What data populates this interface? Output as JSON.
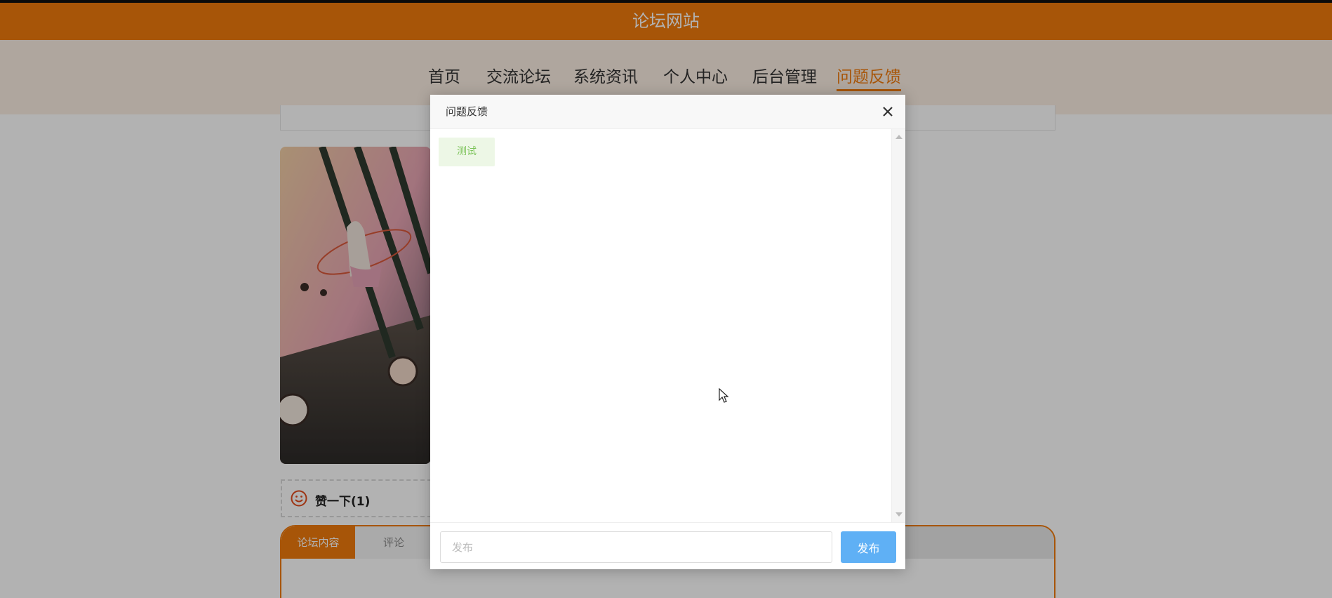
{
  "site": {
    "title": "论坛网站"
  },
  "nav": {
    "items": [
      {
        "label": "首页"
      },
      {
        "label": "交流论坛"
      },
      {
        "label": "系统资讯"
      },
      {
        "label": "个人中心"
      },
      {
        "label": "后台管理"
      },
      {
        "label": "问题反馈",
        "active": true
      }
    ]
  },
  "post": {
    "like_label": "赞一下(1)",
    "tabs": [
      {
        "label": "论坛内容",
        "active": true
      },
      {
        "label": "评论"
      }
    ]
  },
  "modal": {
    "title": "问题反馈",
    "messages": [
      {
        "text": "测试"
      }
    ],
    "input_placeholder": "发布",
    "send_label": "发布"
  },
  "colors": {
    "brand": "#ef7a0c",
    "send_button": "#5fb0f5",
    "message_bg": "#edf7e6",
    "message_text": "#7cc35a"
  }
}
